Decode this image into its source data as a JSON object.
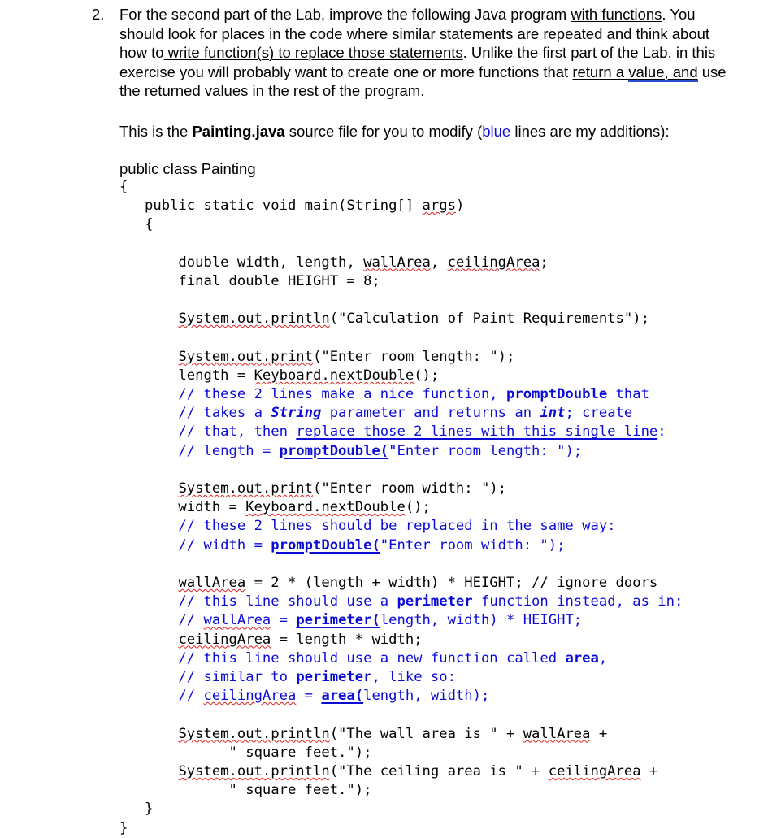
{
  "document": {
    "item_number": "2.",
    "paragraph_1": {
      "segments": [
        {
          "text": "For the second part of the Lab, improve the following Java program ",
          "style": "plain"
        },
        {
          "text": "with functions",
          "style": "underline"
        },
        {
          "text": ". You should ",
          "style": "plain"
        },
        {
          "text": "look for places in the code where similar statements are repeated",
          "style": "underline"
        },
        {
          "text": " and think about how to",
          "style": "plain"
        },
        {
          "text": " write function(s) to replace those statements",
          "style": "underline"
        },
        {
          "text": ". Unlike the first part of the Lab, in this exercise you will probably want to create one or more functions that ",
          "style": "plain"
        },
        {
          "text": "return a ",
          "style": "underline"
        },
        {
          "text": "value, and",
          "style": "underline-grammar"
        },
        {
          "text": " use the returned values",
          "style": "plain"
        },
        {
          "text": " in the rest of the program.",
          "style": "plain"
        }
      ]
    },
    "paragraph_2": {
      "segments": [
        {
          "text": "This is the ",
          "style": "plain"
        },
        {
          "text": "Painting.java",
          "style": "bold"
        },
        {
          "text": " source file for you to modify (",
          "style": "plain"
        },
        {
          "text": "blue",
          "style": "blue"
        },
        {
          "text": " lines are my additions):",
          "style": "plain"
        }
      ]
    },
    "code_listing": {
      "language": "java",
      "class_name": "Painting",
      "lines": [
        {
          "kind": "proportional",
          "text": "public class Painting"
        },
        {
          "kind": "code",
          "parts": [
            {
              "t": "{",
              "s": "plain"
            }
          ]
        },
        {
          "kind": "code",
          "parts": [
            {
              "t": "   public static void main(String[] ",
              "s": "plain"
            },
            {
              "t": "args",
              "s": "squiggle"
            },
            {
              "t": ")",
              "s": "plain"
            }
          ]
        },
        {
          "kind": "code",
          "parts": [
            {
              "t": "   {",
              "s": "plain"
            }
          ]
        },
        {
          "kind": "blank"
        },
        {
          "kind": "code",
          "parts": [
            {
              "t": "       double width, length, ",
              "s": "plain"
            },
            {
              "t": "wallArea",
              "s": "squiggle"
            },
            {
              "t": ", ",
              "s": "plain"
            },
            {
              "t": "ceilingArea",
              "s": "squiggle"
            },
            {
              "t": ";",
              "s": "plain"
            }
          ]
        },
        {
          "kind": "code",
          "parts": [
            {
              "t": "       final double HEIGHT = 8;",
              "s": "plain"
            }
          ]
        },
        {
          "kind": "blank"
        },
        {
          "kind": "code",
          "parts": [
            {
              "t": "       ",
              "s": "plain"
            },
            {
              "t": "System.out.println",
              "s": "squiggle"
            },
            {
              "t": "(\"Calculation of Paint Requirements\");",
              "s": "plain"
            }
          ]
        },
        {
          "kind": "blank"
        },
        {
          "kind": "code",
          "parts": [
            {
              "t": "       ",
              "s": "plain"
            },
            {
              "t": "System.out.print",
              "s": "squiggle"
            },
            {
              "t": "(\"Enter room length: \");",
              "s": "plain"
            }
          ]
        },
        {
          "kind": "code",
          "parts": [
            {
              "t": "       length = ",
              "s": "plain"
            },
            {
              "t": "Keyboard.nextDouble",
              "s": "squiggle"
            },
            {
              "t": "();",
              "s": "plain"
            }
          ]
        },
        {
          "kind": "code",
          "parts": [
            {
              "t": "       // these 2 lines make a nice function, ",
              "s": "comment"
            },
            {
              "t": "promptDouble",
              "s": "comment-bold"
            },
            {
              "t": " that",
              "s": "comment"
            }
          ]
        },
        {
          "kind": "code",
          "parts": [
            {
              "t": "       // takes a ",
              "s": "comment"
            },
            {
              "t": "String",
              "s": "comment-italic"
            },
            {
              "t": " parameter and returns an ",
              "s": "comment"
            },
            {
              "t": "int",
              "s": "comment-italic"
            },
            {
              "t": "; create",
              "s": "comment"
            }
          ]
        },
        {
          "kind": "code",
          "parts": [
            {
              "t": "       // that, then ",
              "s": "comment"
            },
            {
              "t": "replace those 2 lines with this single line",
              "s": "comment-underline"
            },
            {
              "t": ":",
              "s": "comment"
            }
          ]
        },
        {
          "kind": "code",
          "parts": [
            {
              "t": "       // length = ",
              "s": "comment"
            },
            {
              "t": "promptDouble(",
              "s": "comment-bold-underline"
            },
            {
              "t": "\"Enter room length: \");",
              "s": "comment"
            }
          ]
        },
        {
          "kind": "blank"
        },
        {
          "kind": "code",
          "parts": [
            {
              "t": "       ",
              "s": "plain"
            },
            {
              "t": "System.out.print",
              "s": "squiggle"
            },
            {
              "t": "(\"Enter room width: \");",
              "s": "plain"
            }
          ]
        },
        {
          "kind": "code",
          "parts": [
            {
              "t": "       width = ",
              "s": "plain"
            },
            {
              "t": "Keyboard.nextDouble",
              "s": "squiggle"
            },
            {
              "t": "();",
              "s": "plain"
            }
          ]
        },
        {
          "kind": "code",
          "parts": [
            {
              "t": "       // these 2 lines should be replaced in the same way:",
              "s": "comment"
            }
          ]
        },
        {
          "kind": "code",
          "parts": [
            {
              "t": "       // width = ",
              "s": "comment"
            },
            {
              "t": "promptDouble(",
              "s": "comment-bold-underline"
            },
            {
              "t": "\"Enter room width: \");",
              "s": "comment"
            }
          ]
        },
        {
          "kind": "blank"
        },
        {
          "kind": "code",
          "parts": [
            {
              "t": "       ",
              "s": "plain"
            },
            {
              "t": "wallArea",
              "s": "squiggle"
            },
            {
              "t": " = 2 * (length + width) * HEIGHT; // ignore doors",
              "s": "plain"
            }
          ]
        },
        {
          "kind": "code",
          "parts": [
            {
              "t": "       // this line should use a ",
              "s": "comment"
            },
            {
              "t": "perimeter",
              "s": "comment-bold"
            },
            {
              "t": " function instead, as in:",
              "s": "comment"
            }
          ]
        },
        {
          "kind": "code",
          "parts": [
            {
              "t": "       // ",
              "s": "comment"
            },
            {
              "t": "wallArea",
              "s": "comment-squiggle"
            },
            {
              "t": " = ",
              "s": "comment"
            },
            {
              "t": "perimeter(",
              "s": "comment-bold-underline"
            },
            {
              "t": "length, width) * HEIGHT;",
              "s": "comment"
            }
          ]
        },
        {
          "kind": "code",
          "parts": [
            {
              "t": "       ",
              "s": "plain"
            },
            {
              "t": "ceilingArea",
              "s": "squiggle"
            },
            {
              "t": " = length * width;",
              "s": "plain"
            }
          ]
        },
        {
          "kind": "code",
          "parts": [
            {
              "t": "       // this line should use a new function called ",
              "s": "comment"
            },
            {
              "t": "area",
              "s": "comment-bold"
            },
            {
              "t": ",",
              "s": "comment"
            }
          ]
        },
        {
          "kind": "code",
          "parts": [
            {
              "t": "       // similar to ",
              "s": "comment"
            },
            {
              "t": "perimeter",
              "s": "comment-bold"
            },
            {
              "t": ", like so:",
              "s": "comment"
            }
          ]
        },
        {
          "kind": "code",
          "parts": [
            {
              "t": "       // ",
              "s": "comment"
            },
            {
              "t": "ceilingArea",
              "s": "comment-squiggle"
            },
            {
              "t": " = ",
              "s": "comment"
            },
            {
              "t": "area(",
              "s": "comment-bold-underline"
            },
            {
              "t": "length, width);",
              "s": "comment"
            }
          ]
        },
        {
          "kind": "blank"
        },
        {
          "kind": "code",
          "parts": [
            {
              "t": "       ",
              "s": "plain"
            },
            {
              "t": "System.out.println",
              "s": "squiggle"
            },
            {
              "t": "(\"The wall area is \" + ",
              "s": "plain"
            },
            {
              "t": "wallArea",
              "s": "squiggle"
            },
            {
              "t": " +",
              "s": "plain"
            }
          ]
        },
        {
          "kind": "code",
          "parts": [
            {
              "t": "             \" square feet.\");",
              "s": "plain"
            }
          ]
        },
        {
          "kind": "code",
          "parts": [
            {
              "t": "       ",
              "s": "plain"
            },
            {
              "t": "System.out.println",
              "s": "squiggle"
            },
            {
              "t": "(\"The ceiling area is \" + ",
              "s": "plain"
            },
            {
              "t": "ceilingArea",
              "s": "squiggle"
            },
            {
              "t": " +",
              "s": "plain"
            }
          ]
        },
        {
          "kind": "code",
          "parts": [
            {
              "t": "             \" square feet.\");",
              "s": "plain"
            }
          ]
        },
        {
          "kind": "code",
          "parts": [
            {
              "t": "   }",
              "s": "plain"
            }
          ]
        },
        {
          "kind": "code",
          "parts": [
            {
              "t": "}",
              "s": "plain"
            }
          ]
        }
      ]
    },
    "colors": {
      "text": "#000000",
      "annotation_blue": "#0b0bd8",
      "spellcheck_red": "#e02020",
      "grammar_blue": "#2b4ecf",
      "background": "#ffffff"
    }
  }
}
